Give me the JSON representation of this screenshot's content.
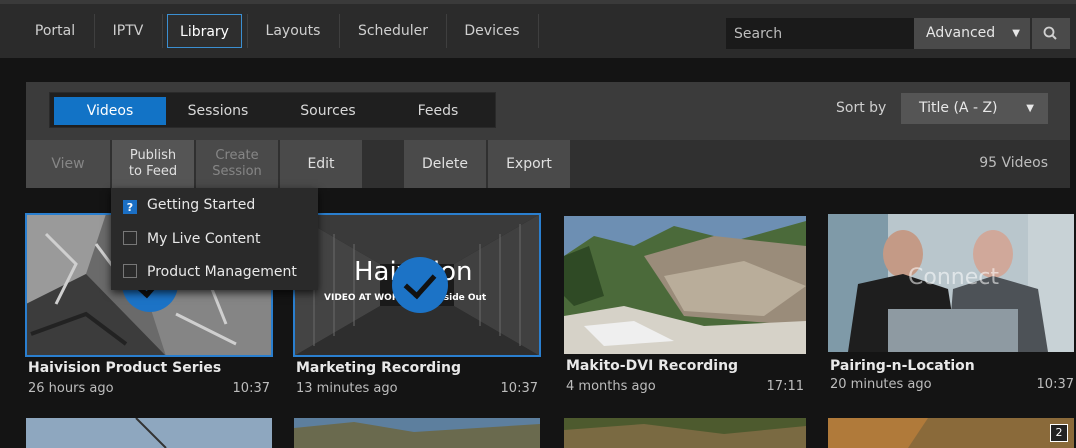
{
  "nav": {
    "items": [
      "Portal",
      "IPTV",
      "Library",
      "Layouts",
      "Scheduler",
      "Devices"
    ],
    "active": "Library",
    "search_placeholder": "Search",
    "advanced_label": "Advanced"
  },
  "library": {
    "tabs": [
      "Videos",
      "Sessions",
      "Sources",
      "Feeds"
    ],
    "active_tab": "Videos",
    "sort_label": "Sort by",
    "sort_value": "Title (A - Z)",
    "toolbar": {
      "view": "View",
      "publish_line1": "Publish",
      "publish_line2": "to Feed",
      "create_line1": "Create",
      "create_line2": "Session",
      "edit": "Edit",
      "delete": "Delete",
      "export": "Export"
    },
    "video_count": "95 Videos",
    "publish_menu": [
      "Getting Started",
      "My Live Content",
      "Product Management"
    ],
    "videos": [
      {
        "title": "Haivision Product Series",
        "age": "26 hours ago",
        "duration": "10:37",
        "selected": true
      },
      {
        "title": "Marketing Recording",
        "age": "13 minutes ago",
        "duration": "10:37",
        "selected": true
      },
      {
        "title": "Makito-DVI Recording",
        "age": "4 months ago",
        "duration": "17:11",
        "selected": false
      },
      {
        "title": "Pairing-n-Location",
        "age": "20 minutes ago",
        "duration": "10:37",
        "selected": false
      }
    ],
    "thumb_marketing": {
      "brand": "Haivision",
      "tagline": "VIDEO AT WORK · SM Inside Out"
    },
    "thumb_pairing": {
      "watermark": "Connect"
    },
    "row2_badge": "2"
  },
  "colors": {
    "accent": "#1273c6",
    "selection": "#2a7fcf"
  }
}
